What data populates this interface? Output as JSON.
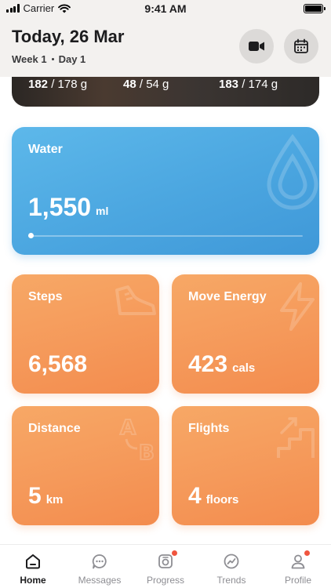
{
  "status": {
    "carrier": "Carrier",
    "time": "9:41 AM"
  },
  "header": {
    "title": "Today, 26 Mar",
    "week": "Week 1",
    "day": "Day 1"
  },
  "nutrition": [
    {
      "value": "182",
      "target": " / 178 g"
    },
    {
      "value": "48",
      "target": " / 54 g"
    },
    {
      "value": "183",
      "target": " / 174 g"
    }
  ],
  "water": {
    "label": "Water",
    "value": "1,550",
    "unit": "ml",
    "progress": 0.01
  },
  "steps": {
    "label": "Steps",
    "value": "6,568"
  },
  "move": {
    "label": "Move Energy",
    "value": "423",
    "unit": "cals"
  },
  "distance": {
    "label": "Distance",
    "value": "5",
    "unit": "km"
  },
  "flights": {
    "label": "Flights",
    "value": "4",
    "unit": "floors"
  },
  "tabs": [
    {
      "label": "Home",
      "icon": "home-icon",
      "active": true
    },
    {
      "label": "Messages",
      "icon": "messages-icon",
      "badge": false
    },
    {
      "label": "Progress",
      "icon": "progress-icon",
      "badge": true
    },
    {
      "label": "Trends",
      "icon": "trends-icon",
      "badge": false
    },
    {
      "label": "Profile",
      "icon": "profile-icon",
      "badge": true
    }
  ],
  "colors": {
    "water": "#4ba6e0",
    "orange": "#f5995a",
    "badge": "#f0553f"
  }
}
